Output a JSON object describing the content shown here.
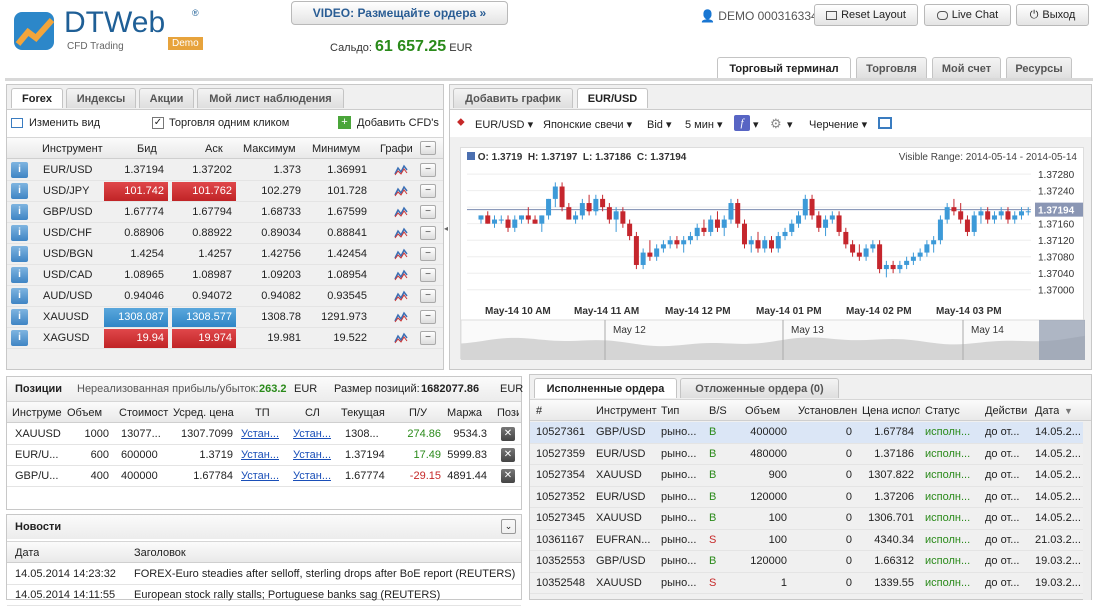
{
  "header": {
    "logo_text": "DTWeb",
    "logo_sub": "CFD Trading",
    "logo_badge": "Demo",
    "logo_tm": "®",
    "video_button": "VIDEO: Размещайте ордера »",
    "balance_label": "Сальдо:",
    "balance_value": "61 657.25",
    "balance_currency": "EUR",
    "account": "DEMO 000316334",
    "reset_layout": "Reset Layout",
    "live_chat": "Live Chat",
    "logout": "Выход"
  },
  "main_tabs": [
    "Торговый терминал",
    "Торговля",
    "Мой счет",
    "Ресурсы"
  ],
  "quotes": {
    "tabs": [
      "Forex",
      "Индексы",
      "Акции",
      "Мой лист наблюдения"
    ],
    "toolbar": {
      "edit_view": "Изменить вид",
      "one_click": "Торговля одним кликом",
      "add_cfd": "Добавить CFD's"
    },
    "columns": [
      "Инструмент",
      "Бид",
      "Аск",
      "Максимум",
      "Минимум",
      "Графи"
    ],
    "rows": [
      {
        "symbol": "EUR/USD",
        "bid": "1.37194",
        "ask": "1.37202",
        "high": "1.373",
        "low": "1.36991",
        "state": "none"
      },
      {
        "symbol": "USD/JPY",
        "bid": "101.742",
        "ask": "101.762",
        "high": "102.279",
        "low": "101.728",
        "state": "down"
      },
      {
        "symbol": "GBP/USD",
        "bid": "1.67774",
        "ask": "1.67794",
        "high": "1.68733",
        "low": "1.67599",
        "state": "none"
      },
      {
        "symbol": "USD/CHF",
        "bid": "0.88906",
        "ask": "0.88922",
        "high": "0.89034",
        "low": "0.88841",
        "state": "none"
      },
      {
        "symbol": "USD/BGN",
        "bid": "1.4254",
        "ask": "1.4257",
        "high": "1.42756",
        "low": "1.42454",
        "state": "none"
      },
      {
        "symbol": "USD/CAD",
        "bid": "1.08965",
        "ask": "1.08987",
        "high": "1.09203",
        "low": "1.08954",
        "state": "none"
      },
      {
        "symbol": "AUD/USD",
        "bid": "0.94046",
        "ask": "0.94072",
        "high": "0.94082",
        "low": "0.93545",
        "state": "none"
      },
      {
        "symbol": "XAUUSD",
        "bid": "1308.087",
        "ask": "1308.577",
        "high": "1308.78",
        "low": "1291.973",
        "state": "up"
      },
      {
        "symbol": "XAGUSD",
        "bid": "19.94",
        "ask": "19.974",
        "high": "19.981",
        "low": "19.522",
        "state": "down"
      }
    ]
  },
  "chart_panel": {
    "tabs": [
      "Добавить график",
      "EUR/USD"
    ],
    "toolbar": {
      "symbol": "EUR/USD",
      "chart_type": "Японские свечи",
      "price": "Bid",
      "interval": "5 мин",
      "drawing": "Черчение"
    },
    "ohlc_label": {
      "o": "O:",
      "o_val": "1.3719",
      "h": "H:",
      "h_val": "1.37197",
      "l": "L:",
      "l_val": "1.37186",
      "c": "C:",
      "c_val": "1.37194"
    },
    "visible_range": "Visible Range: 2014-05-14 - 2014-05-14",
    "nav_dates": [
      "May 12",
      "May 13",
      "May 14"
    ]
  },
  "chart_data": {
    "type": "candlestick",
    "title": "EUR/USD",
    "interval": "5 min",
    "y_ticks": [
      "1.37280",
      "1.37240",
      "1.37200",
      "1.37160",
      "1.37120",
      "1.37080",
      "1.37040",
      "1.37000"
    ],
    "ylim": [
      1.3698,
      1.3729
    ],
    "x_ticks": [
      "May-14 10 AM",
      "May-14 11 AM",
      "May-14 12 PM",
      "May-14 01 PM",
      "May-14 02 PM",
      "May-14 03 PM"
    ],
    "last_price": "1.37194",
    "candles": [
      [
        1.3717,
        1.3718,
        1.3716,
        1.3718
      ],
      [
        1.3718,
        1.3719,
        1.3716,
        1.3716
      ],
      [
        1.3716,
        1.3718,
        1.3715,
        1.3717
      ],
      [
        1.3717,
        1.3718,
        1.3716,
        1.3717
      ],
      [
        1.3717,
        1.3718,
        1.3714,
        1.3715
      ],
      [
        1.3715,
        1.3718,
        1.3714,
        1.3717
      ],
      [
        1.3717,
        1.3718,
        1.3716,
        1.3718
      ],
      [
        1.3718,
        1.372,
        1.3716,
        1.3717
      ],
      [
        1.3717,
        1.3718,
        1.3716,
        1.3716
      ],
      [
        1.3716,
        1.3718,
        1.3714,
        1.3718
      ],
      [
        1.3718,
        1.3722,
        1.3717,
        1.3722
      ],
      [
        1.3722,
        1.3726,
        1.372,
        1.3725
      ],
      [
        1.3725,
        1.3726,
        1.3719,
        1.372
      ],
      [
        1.372,
        1.3721,
        1.3717,
        1.3717
      ],
      [
        1.3717,
        1.3719,
        1.3716,
        1.3718
      ],
      [
        1.3718,
        1.3722,
        1.3717,
        1.3721
      ],
      [
        1.3721,
        1.3723,
        1.3718,
        1.3719
      ],
      [
        1.3719,
        1.3723,
        1.3718,
        1.3722
      ],
      [
        1.3722,
        1.3723,
        1.3719,
        1.372
      ],
      [
        1.372,
        1.3721,
        1.3716,
        1.3717
      ],
      [
        1.3717,
        1.372,
        1.3714,
        1.3719
      ],
      [
        1.3719,
        1.372,
        1.3715,
        1.3716
      ],
      [
        1.3716,
        1.3717,
        1.3712,
        1.3713
      ],
      [
        1.3713,
        1.3714,
        1.3705,
        1.3706
      ],
      [
        1.3706,
        1.371,
        1.3705,
        1.3709
      ],
      [
        1.3709,
        1.3712,
        1.3707,
        1.3708
      ],
      [
        1.3708,
        1.3711,
        1.3707,
        1.371
      ],
      [
        1.371,
        1.3712,
        1.3709,
        1.3711
      ],
      [
        1.3711,
        1.3713,
        1.371,
        1.3712
      ],
      [
        1.3712,
        1.3713,
        1.371,
        1.3711
      ],
      [
        1.3711,
        1.3713,
        1.3709,
        1.3712
      ],
      [
        1.3712,
        1.3714,
        1.3711,
        1.3713
      ],
      [
        1.3713,
        1.3716,
        1.3712,
        1.3715
      ],
      [
        1.3715,
        1.3717,
        1.3713,
        1.3714
      ],
      [
        1.3714,
        1.3718,
        1.3713,
        1.3717
      ],
      [
        1.3717,
        1.3719,
        1.3714,
        1.3715
      ],
      [
        1.3715,
        1.3718,
        1.3713,
        1.3717
      ],
      [
        1.3717,
        1.3722,
        1.3716,
        1.3721
      ],
      [
        1.3721,
        1.3722,
        1.3715,
        1.3716
      ],
      [
        1.3716,
        1.3717,
        1.371,
        1.3711
      ],
      [
        1.3711,
        1.3713,
        1.3709,
        1.3712
      ],
      [
        1.3712,
        1.3714,
        1.3709,
        1.371
      ],
      [
        1.371,
        1.3713,
        1.3709,
        1.3712
      ],
      [
        1.3712,
        1.3713,
        1.3709,
        1.371
      ],
      [
        1.371,
        1.3714,
        1.3709,
        1.3713
      ],
      [
        1.3713,
        1.3715,
        1.3712,
        1.3714
      ],
      [
        1.3714,
        1.3717,
        1.3713,
        1.3716
      ],
      [
        1.3716,
        1.3719,
        1.3715,
        1.3718
      ],
      [
        1.3718,
        1.3723,
        1.3717,
        1.3722
      ],
      [
        1.3722,
        1.3723,
        1.3717,
        1.3718
      ],
      [
        1.3718,
        1.3719,
        1.3714,
        1.3715
      ],
      [
        1.3715,
        1.3718,
        1.3713,
        1.3717
      ],
      [
        1.3717,
        1.3719,
        1.3716,
        1.3718
      ],
      [
        1.3718,
        1.3719,
        1.3713,
        1.3714
      ],
      [
        1.3714,
        1.3715,
        1.371,
        1.3711
      ],
      [
        1.3711,
        1.3712,
        1.3708,
        1.3709
      ],
      [
        1.3709,
        1.3711,
        1.3707,
        1.3708
      ],
      [
        1.3708,
        1.3711,
        1.3707,
        1.371
      ],
      [
        1.371,
        1.3712,
        1.3709,
        1.3711
      ],
      [
        1.3711,
        1.3712,
        1.3704,
        1.3705
      ],
      [
        1.3705,
        1.3707,
        1.3703,
        1.3706
      ],
      [
        1.3706,
        1.3707,
        1.3704,
        1.3705
      ],
      [
        1.3705,
        1.3707,
        1.3704,
        1.3706
      ],
      [
        1.3706,
        1.3708,
        1.3705,
        1.3707
      ],
      [
        1.3707,
        1.3709,
        1.3706,
        1.3708
      ],
      [
        1.3708,
        1.371,
        1.3707,
        1.3709
      ],
      [
        1.3709,
        1.3712,
        1.3708,
        1.3711
      ],
      [
        1.3711,
        1.3713,
        1.3709,
        1.3712
      ],
      [
        1.3712,
        1.3718,
        1.3711,
        1.3717
      ],
      [
        1.3717,
        1.3721,
        1.3716,
        1.372
      ],
      [
        1.372,
        1.3722,
        1.3718,
        1.3719
      ],
      [
        1.3719,
        1.3721,
        1.3716,
        1.3717
      ],
      [
        1.3717,
        1.3718,
        1.3713,
        1.3714
      ],
      [
        1.3714,
        1.3719,
        1.3713,
        1.3718
      ],
      [
        1.3718,
        1.372,
        1.3716,
        1.3719
      ],
      [
        1.3719,
        1.372,
        1.3716,
        1.3717
      ],
      [
        1.3717,
        1.3719,
        1.3716,
        1.3718
      ],
      [
        1.3718,
        1.372,
        1.3717,
        1.3719
      ],
      [
        1.3719,
        1.372,
        1.3716,
        1.3717
      ],
      [
        1.3717,
        1.3719,
        1.3716,
        1.3718
      ],
      [
        1.3718,
        1.372,
        1.3717,
        1.3719
      ],
      [
        1.3719,
        1.372,
        1.3718,
        1.3719
      ]
    ]
  },
  "positions": {
    "title": "Позиции",
    "unrealized_label": "Нереализованная прибыль/убыток:",
    "unrealized_value": "263.2",
    "unrealized_currency": "EUR",
    "size_label": "Размер позиций:",
    "size_value": "1682077.86",
    "size_currency": "EUR",
    "columns": [
      "Инструме",
      "Объем",
      "Стоимост",
      "Усред. цена",
      "ТП",
      "СЛ",
      "Текущая",
      "П/У",
      "Маржа",
      "Пози"
    ],
    "rows": [
      {
        "symbol": "XAUUSD",
        "volume": "1000",
        "value": "13077...",
        "avg": "1307.7099",
        "tp": "Устан...",
        "sl": "Устан...",
        "current": "1308...",
        "pl": "274.86",
        "margin": "9534.3",
        "pl_sign": "pos"
      },
      {
        "symbol": "EUR/U...",
        "volume": "600",
        "value": "600000",
        "avg": "1.3719",
        "tp": "Устан...",
        "sl": "Устан...",
        "current": "1.37194",
        "pl": "17.49",
        "margin": "5999.83",
        "pl_sign": "pos"
      },
      {
        "symbol": "GBP/U...",
        "volume": "400",
        "value": "400000",
        "avg": "1.67784",
        "tp": "Устан...",
        "sl": "Устан...",
        "current": "1.67774",
        "pl": "-29.15",
        "margin": "4891.44",
        "pl_sign": "neg"
      }
    ]
  },
  "news": {
    "title": "Новости",
    "columns": [
      "Дата",
      "Заголовок"
    ],
    "rows": [
      {
        "date": "14.05.2014 14:23:32",
        "headline": "FOREX-Euro steadies after selloff, sterling drops after BoE report (REUTERS)"
      },
      {
        "date": "14.05.2014 14:11:55",
        "headline": "European stock rally stalls; Portuguese banks sag (REUTERS)"
      }
    ]
  },
  "orders": {
    "tabs": [
      "Исполненные ордера",
      "Отложенные ордера (0)"
    ],
    "columns": [
      "#",
      "Инструмент",
      "Тип",
      "B/S",
      "Объем",
      "Установлен",
      "Цена испол",
      "Статус",
      "Действи",
      "Дата"
    ],
    "rows": [
      {
        "id": "10527361",
        "symbol": "GBP/USD",
        "type": "рыно...",
        "bs": "B",
        "volume": "400000",
        "set": "0",
        "price": "1.67784",
        "status": "исполн...",
        "action": "до от...",
        "date": "14.05.2..."
      },
      {
        "id": "10527359",
        "symbol": "EUR/USD",
        "type": "рыно...",
        "bs": "B",
        "volume": "480000",
        "set": "0",
        "price": "1.37186",
        "status": "исполн...",
        "action": "до от...",
        "date": "14.05.2..."
      },
      {
        "id": "10527354",
        "symbol": "XAUUSD",
        "type": "рыно...",
        "bs": "B",
        "volume": "900",
        "set": "0",
        "price": "1307.822",
        "status": "исполн...",
        "action": "до от...",
        "date": "14.05.2..."
      },
      {
        "id": "10527352",
        "symbol": "EUR/USD",
        "type": "рыно...",
        "bs": "B",
        "volume": "120000",
        "set": "0",
        "price": "1.37206",
        "status": "исполн...",
        "action": "до от...",
        "date": "14.05.2..."
      },
      {
        "id": "10527345",
        "symbol": "XAUUSD",
        "type": "рыно...",
        "bs": "B",
        "volume": "100",
        "set": "0",
        "price": "1306.701",
        "status": "исполн...",
        "action": "до от...",
        "date": "14.05.2..."
      },
      {
        "id": "10361167",
        "symbol": "EUFRAN...",
        "type": "рыно...",
        "bs": "S",
        "volume": "100",
        "set": "0",
        "price": "4340.34",
        "status": "исполн...",
        "action": "до от...",
        "date": "21.03.2..."
      },
      {
        "id": "10352553",
        "symbol": "GBP/USD",
        "type": "рыно...",
        "bs": "B",
        "volume": "120000",
        "set": "0",
        "price": "1.66312",
        "status": "исполн...",
        "action": "до от...",
        "date": "19.03.2..."
      },
      {
        "id": "10352548",
        "symbol": "XAUUSD",
        "type": "рыно...",
        "bs": "S",
        "volume": "1",
        "set": "0",
        "price": "1339.55",
        "status": "исполн...",
        "action": "до от...",
        "date": "19.03.2..."
      }
    ]
  },
  "colors": {
    "buy": "#2a8a1a",
    "sell": "#c62828",
    "accent": "#2f86c6"
  }
}
